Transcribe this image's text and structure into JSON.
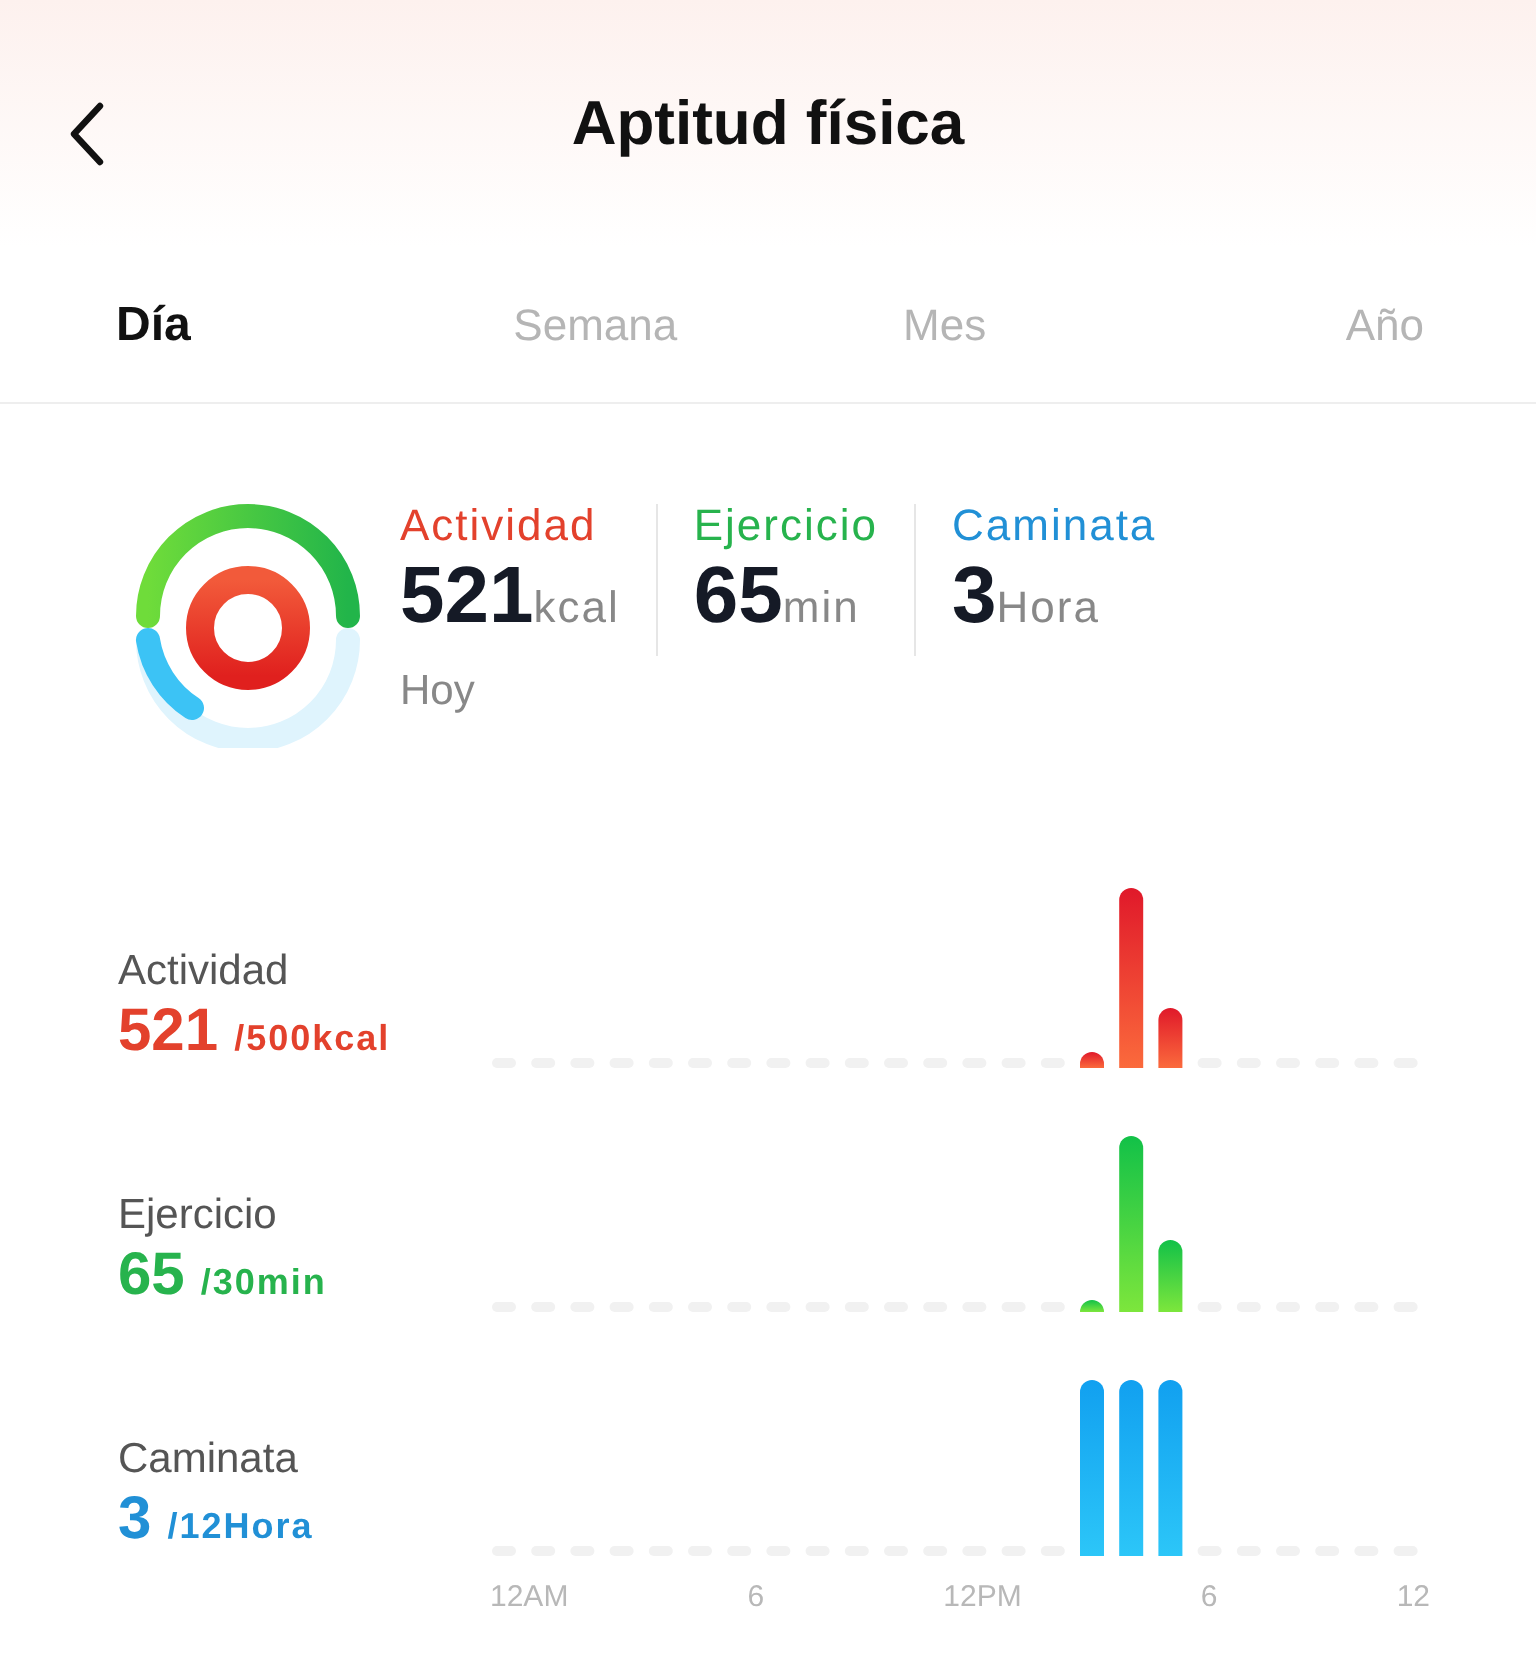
{
  "header": {
    "title": "Aptitud física"
  },
  "tabs": [
    {
      "label": "Día",
      "selected": true
    },
    {
      "label": "Semana",
      "selected": false
    },
    {
      "label": "Mes",
      "selected": false
    },
    {
      "label": "Año",
      "selected": false
    }
  ],
  "summary": {
    "metrics": [
      {
        "label": "Actividad",
        "value": "521",
        "unit": "kcal",
        "color": "#e3412c"
      },
      {
        "label": "Ejercicio",
        "value": "65",
        "unit": "min",
        "color": "#27b34d"
      },
      {
        "label": "Caminata",
        "value": "3",
        "unit": "Hora",
        "color": "#2190d6"
      }
    ],
    "note": "Hoy"
  },
  "charts": [
    {
      "kind": "activity",
      "label": "Actividad",
      "value": "521",
      "goal": "/500kcal"
    },
    {
      "kind": "exercise",
      "label": "Ejercicio",
      "value": "65",
      "goal": "/30min"
    },
    {
      "kind": "walking",
      "label": "Caminata",
      "value": "3",
      "goal": "/12Hora"
    }
  ],
  "x_axis_labels": [
    "12AM",
    "6",
    "12PM",
    "6",
    "12"
  ]
}
